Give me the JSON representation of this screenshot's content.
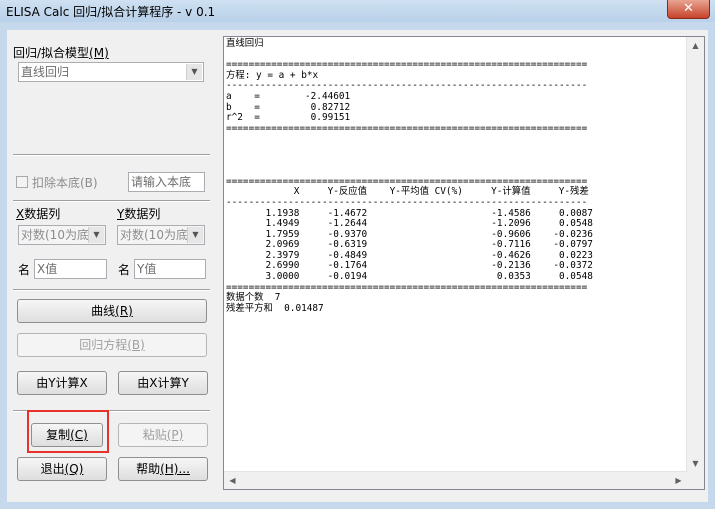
{
  "window": {
    "title": "ELISA Calc 回归/拟合计算程序 - v 0.1",
    "close_glyph": "✕"
  },
  "left_panel": {
    "model_label": "回归/拟合模型",
    "model_key": "(M)",
    "model_value": "直线回归",
    "subtract_bg_label": "扣除本底(B)",
    "bg_input_placeholder": "请输入本底",
    "x_col_label_key": "X",
    "x_col_label": "数据列",
    "y_col_label_key": "Y",
    "y_col_label": "数据列",
    "x_transform": "对数(10为底",
    "y_transform": "对数(10为底",
    "x_name_label": "名",
    "x_name_value": "X值",
    "y_name_label": "名",
    "y_name_value": "Y值",
    "curve_label": "曲线",
    "curve_key": "(R)",
    "regress_eq_label": "回归方程",
    "regress_eq_key": "(B)",
    "calc_x_label": "由Y计算X",
    "calc_y_label": "由X计算Y",
    "copy_label": "复制",
    "copy_key": "(C)",
    "paste_label": "粘贴",
    "paste_key": "(P)",
    "exit_label": "退出",
    "exit_key": "(Q)",
    "help_label": "帮助",
    "help_key": "(H)..."
  },
  "output": {
    "text": "直线回归\n\n================================================================\n方程: y = a + b*x\n----------------------------------------------------------------\na    =        -2.44601\nb    =         0.82712\nr^2  =         0.99151\n================================================================\n\n\n\n\n================================================================\n            X     Y-反应值    Y-平均值 CV(%)     Y-计算值     Y-残差\n----------------------------------------------------------------\n       1.1938     -1.4672                      -1.4586     0.0087\n       1.4949     -1.2644                      -1.2096     0.0548\n       1.7959     -0.9370                      -0.9606    -0.0236\n       2.0969     -0.6319                      -0.7116    -0.0797\n       2.3979     -0.4849                      -0.4626     0.0223\n       2.6990     -0.1764                      -0.2136    -0.0372\n       3.0000     -0.0194                       0.0353     0.0548\n================================================================\n数据个数  7\n残差平方和  0.01487",
    "scroll_up": "▲",
    "scroll_down": "▼",
    "scroll_left": "◀",
    "scroll_right": "▶"
  },
  "colors": {
    "highlight_box": "#e8312a",
    "close_button": "#c7432b"
  }
}
